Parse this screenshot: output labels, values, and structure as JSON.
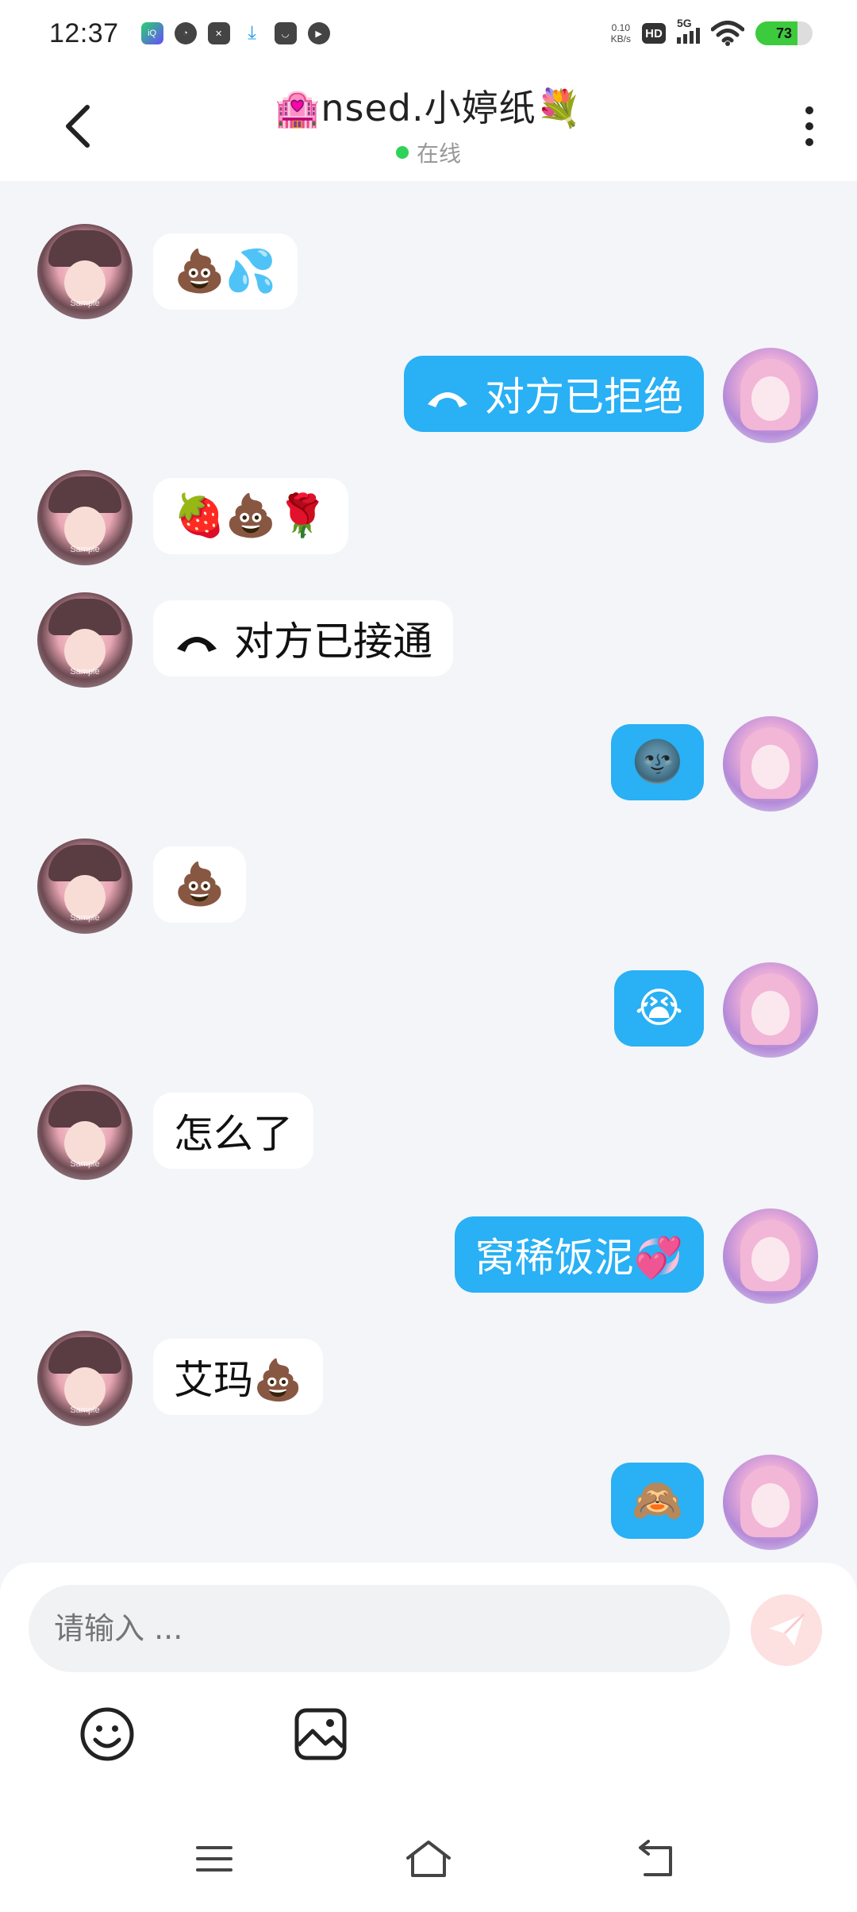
{
  "status_bar": {
    "time": "12:37",
    "net_speed_top": "0.10",
    "net_speed_bottom": "KB/s",
    "hd": "HD",
    "network": "5G",
    "battery": "73",
    "battery_level": 0.73,
    "apps": [
      "iQIYI",
      "compass",
      "capcut",
      "download",
      "mail",
      "play"
    ]
  },
  "header": {
    "title_prefix_emoji": "🏩",
    "title": "nsed.小婷纸",
    "title_suffix_emoji": "💐",
    "presence": "在线"
  },
  "messages": [
    {
      "side": "in",
      "text": "💩💦"
    },
    {
      "side": "out",
      "icon": "call-icon",
      "text": "对方已拒绝"
    },
    {
      "side": "in",
      "text": "🍓💩🌹"
    },
    {
      "side": "in",
      "icon": "call-icon",
      "text": "对方已接通"
    },
    {
      "side": "out",
      "text": "🌚"
    },
    {
      "side": "in",
      "text": "💩"
    },
    {
      "side": "out",
      "text": "😭"
    },
    {
      "side": "in",
      "text": "怎么了"
    },
    {
      "side": "out",
      "text": "窝稀饭泥💞"
    },
    {
      "side": "in",
      "text": "艾玛💩"
    },
    {
      "side": "out",
      "text": "🙈"
    }
  ],
  "avatar_watermark": "Sample",
  "composer": {
    "placeholder": "请输入 ...",
    "tools": [
      "emoji-icon",
      "image-icon"
    ],
    "send_icon": "send-icon"
  },
  "navbar": {
    "buttons": [
      "menu-icon",
      "home-icon",
      "back-icon"
    ]
  }
}
